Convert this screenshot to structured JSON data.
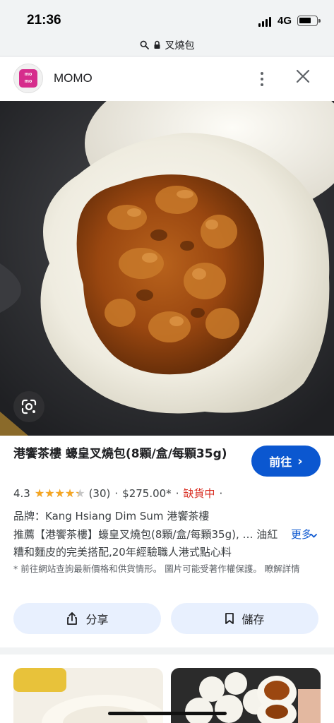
{
  "status_bar": {
    "time": "21:36",
    "network": "4G",
    "icons": [
      "signal-icon",
      "battery-icon"
    ]
  },
  "url_bar": {
    "text": "叉燒包",
    "icons": [
      "search-icon",
      "lock-icon"
    ]
  },
  "site": {
    "name": "MOMO",
    "logo_text": "momo",
    "logo_color": "#d62d8c"
  },
  "product": {
    "title": "港饗茶樓 蠔皇叉燒包(8顆/盒/每顆35g)",
    "go_button": "前往",
    "rating": {
      "score": "4.3",
      "score_value": 4.3,
      "max": 5,
      "count": "(30)"
    },
    "price": "$275.00*",
    "stock_status": "缺貨中",
    "separator": "·",
    "brand": "品牌：Kang Hsiang Dim Sum 港饗茶樓",
    "description": "推薦【港饗茶樓】蠔皇叉燒包(8顆/盒/每顆35g), … 油紅糟和麵皮的完美搭配,20年經驗職人港式點心料",
    "more_label": "更多",
    "disclaimer": "* 前往網站查詢最新價格和供貨情形。 圖片可能受著作權保護。 瞭解詳情"
  },
  "actions": {
    "share": "分享",
    "save": "儲存"
  },
  "colors": {
    "accent": "#0b57d0",
    "star": "#f5a623",
    "out_of_stock": "#d93025",
    "action_bg": "#e8f0fe"
  }
}
